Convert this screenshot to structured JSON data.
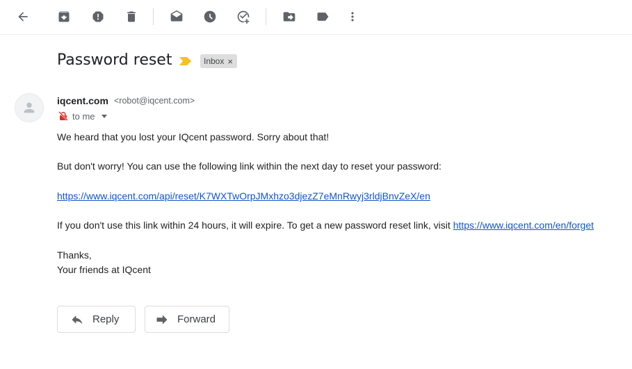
{
  "toolbar": {
    "icons": [
      "back-arrow-icon",
      "archive-icon",
      "report-spam-icon",
      "delete-icon",
      "mark-unread-icon",
      "snooze-icon",
      "add-to-tasks-icon",
      "move-to-icon",
      "labels-icon",
      "more-vert-icon"
    ]
  },
  "message": {
    "subject": "Password reset",
    "label": "Inbox",
    "label_close": "×",
    "sender_name": "iqcent.com",
    "sender_email": "<robot@iqcent.com>",
    "recipient": "to me",
    "body": {
      "line1": "We heard that you lost your IQcent password. Sorry about that!",
      "line2": "But don't worry! You can use the following link within the next day to reset your password:",
      "reset_link": "https://www.iqcent.com/api/reset/K7WXTwOrpJMxhzo3djezZ7eMnRwyj3rldjBnvZeX/en",
      "line4_prefix": "If you don't use this link within 24 hours, it will expire. To get a new password reset link, visit ",
      "forget_link": "https://www.iqcent.com/en/forget",
      "closing1": "Thanks,",
      "closing2": "Your friends at IQcent"
    }
  },
  "actions": {
    "reply_label": "Reply",
    "forward_label": "Forward"
  },
  "colors": {
    "link": "#1155cc",
    "importance": "#f6c026",
    "label_bg": "#dddddd"
  }
}
